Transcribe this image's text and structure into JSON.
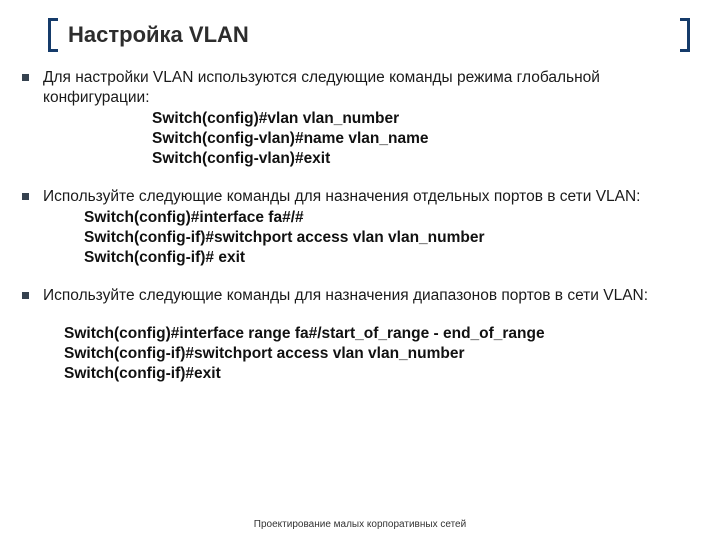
{
  "title": "Настройка VLAN",
  "sections": [
    {
      "lead": "Для настройки VLAN используются следующие команды режима глобальной конфигурации:",
      "indentClass": "ind1",
      "cmds": [
        "Switch(config)#vlan vlan_number",
        "Switch(config-vlan)#name vlan_name",
        "Switch(config-vlan)#exit"
      ]
    },
    {
      "lead": "Используйте следующие команды для назначения отдельных портов в сети VLAN:",
      "indentClass": "ind2",
      "cmds": [
        "Switch(config)#interface fa#/#",
        "Switch(config-if)#switchport access vlan vlan_number",
        "Switch(config-if)# exit"
      ]
    },
    {
      "lead": "Используйте следующие команды для назначения диапазонов портов в сети VLAN:",
      "indentClass": "ind3",
      "cmds": [
        "Switch(config)#interface range fa#/start_of_range - end_of_range",
        "Switch(config-if)#switchport access vlan vlan_number",
        "Switch(config-if)#exit"
      ]
    }
  ],
  "footer": "Проектирование малых корпоративных сетей"
}
